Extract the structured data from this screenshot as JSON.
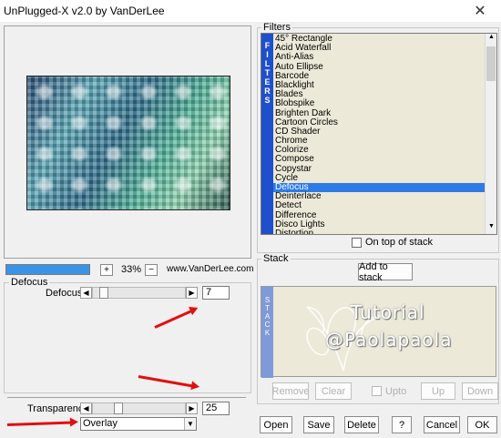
{
  "window": {
    "title": "UnPlugged-X v2.0 by VanDerLee",
    "close_glyph": "✕"
  },
  "zoom": {
    "minus_label": "−",
    "plus_label": "+",
    "value": "33%",
    "credit": "www.VanDerLee.com"
  },
  "defocus_group": {
    "title": "Defocus",
    "param_label": "Defocus",
    "value": "7",
    "slider_fraction": 0.07
  },
  "transparency": {
    "label": "Transparency",
    "value": "25",
    "slider_fraction": 0.25
  },
  "blend_mode": {
    "selected": "Overlay"
  },
  "filters": {
    "title": "Filters",
    "side_label": [
      "F",
      "I",
      "L",
      "T",
      "E",
      "R",
      "S"
    ],
    "items": [
      "45° Rectangle",
      "Acid Waterfall",
      "Anti-Alias",
      "Auto Ellipse",
      "Barcode",
      "Blacklight",
      "Blades",
      "Blobspike",
      "Brighten Dark",
      "Cartoon Circles",
      "CD Shader",
      "Chrome",
      "Colorize",
      "Compose",
      "Copystar",
      "Cycle",
      "Defocus",
      "Deinterlace",
      "Detect",
      "Difference",
      "Disco Lights",
      "Distortion"
    ],
    "selected": "Defocus",
    "on_top_label": "On top of stack"
  },
  "stack": {
    "title": "Stack",
    "add_label": "Add to stack",
    "side_label": [
      "S",
      "T",
      "A",
      "C",
      "K"
    ],
    "remove_label": "Remove",
    "clear_label": "Clear",
    "upto_label": "Upto",
    "up_label": "Up",
    "down_label": "Down"
  },
  "watermark": {
    "line1": "Tutorial",
    "line2": "@Paolapaola"
  },
  "footer": {
    "open": "Open",
    "save": "Save",
    "delete": "Delete",
    "help": "?",
    "cancel": "Cancel",
    "ok": "OK"
  },
  "colors": {
    "selection": "#2f7be6",
    "side_strip": "#1e4fcc",
    "list_bg": "#ece9d8",
    "annotation": "#e01010"
  }
}
